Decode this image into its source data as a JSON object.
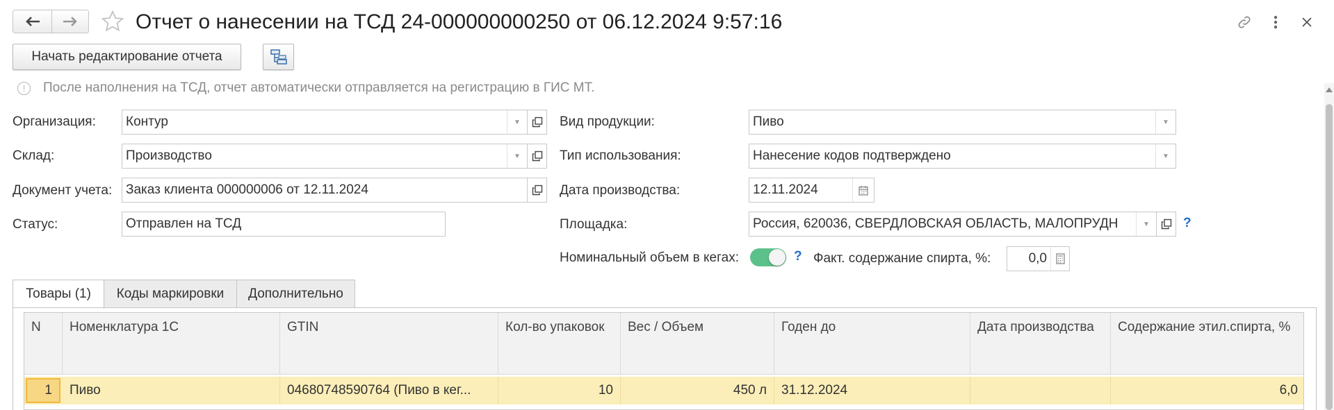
{
  "header": {
    "title": "Отчет о нанесении на ТСД 24-000000000250 от 06.12.2024 9:57:16",
    "back_icon": "arrow-left-icon",
    "forward_icon": "arrow-right-icon",
    "star_icon": "star-icon",
    "link_icon": "link-icon",
    "more_icon": "more-vertical-icon",
    "close_icon": "close-icon"
  },
  "toolbar": {
    "edit_button": "Начать редактирование отчета",
    "structure_icon": "hierarchy-icon"
  },
  "info_text": "После наполнения на ТСД, отчет автоматически отправляется на регистрацию в ГИС МТ.",
  "form": {
    "organization": {
      "label": "Организация:",
      "value": "Контур"
    },
    "warehouse": {
      "label": "Склад:",
      "value": "Производство"
    },
    "document": {
      "label": "Документ учета:",
      "value": "Заказ клиента 000000006 от 12.11.2024"
    },
    "status": {
      "label": "Статус:",
      "value": "Отправлен на ТСД"
    },
    "product_type": {
      "label": "Вид продукции:",
      "value": "Пиво"
    },
    "usage_type": {
      "label": "Тип использования:",
      "value": "Нанесение кодов подтверждено"
    },
    "production_date": {
      "label": "Дата производства:",
      "value": "12.11.2024"
    },
    "site": {
      "label": "Площадка:",
      "value": "Россия, 620036, СВЕРДЛОВСКАЯ ОБЛАСТЬ, МАЛОПРУДН",
      "help": "?"
    },
    "nominal_volume": {
      "label": "Номинальный объем в кегах:",
      "toggle_on": true,
      "help": "?"
    },
    "alcohol": {
      "label": "Факт. содержание спирта, %:",
      "value": "0,0"
    }
  },
  "tabs": [
    {
      "label": "Товары (1)",
      "active": true
    },
    {
      "label": "Коды маркировки",
      "active": false
    },
    {
      "label": "Дополнительно",
      "active": false
    }
  ],
  "table": {
    "columns": [
      "N",
      "Номенклатура 1С",
      "GTIN",
      "Кол-во упаковок",
      "Вес / Объем",
      "Годен до",
      "Дата производства",
      "Содержание этил.спирта, %"
    ],
    "rows": [
      [
        "1",
        "Пиво",
        "04680748590764 (Пиво в кег...",
        "10",
        "450 л",
        "31.12.2024",
        "",
        "6,0"
      ]
    ]
  },
  "colors": {
    "toggle": "#5cc08a",
    "row_selected": "#fbeeb8",
    "help": "#1d70c8"
  }
}
